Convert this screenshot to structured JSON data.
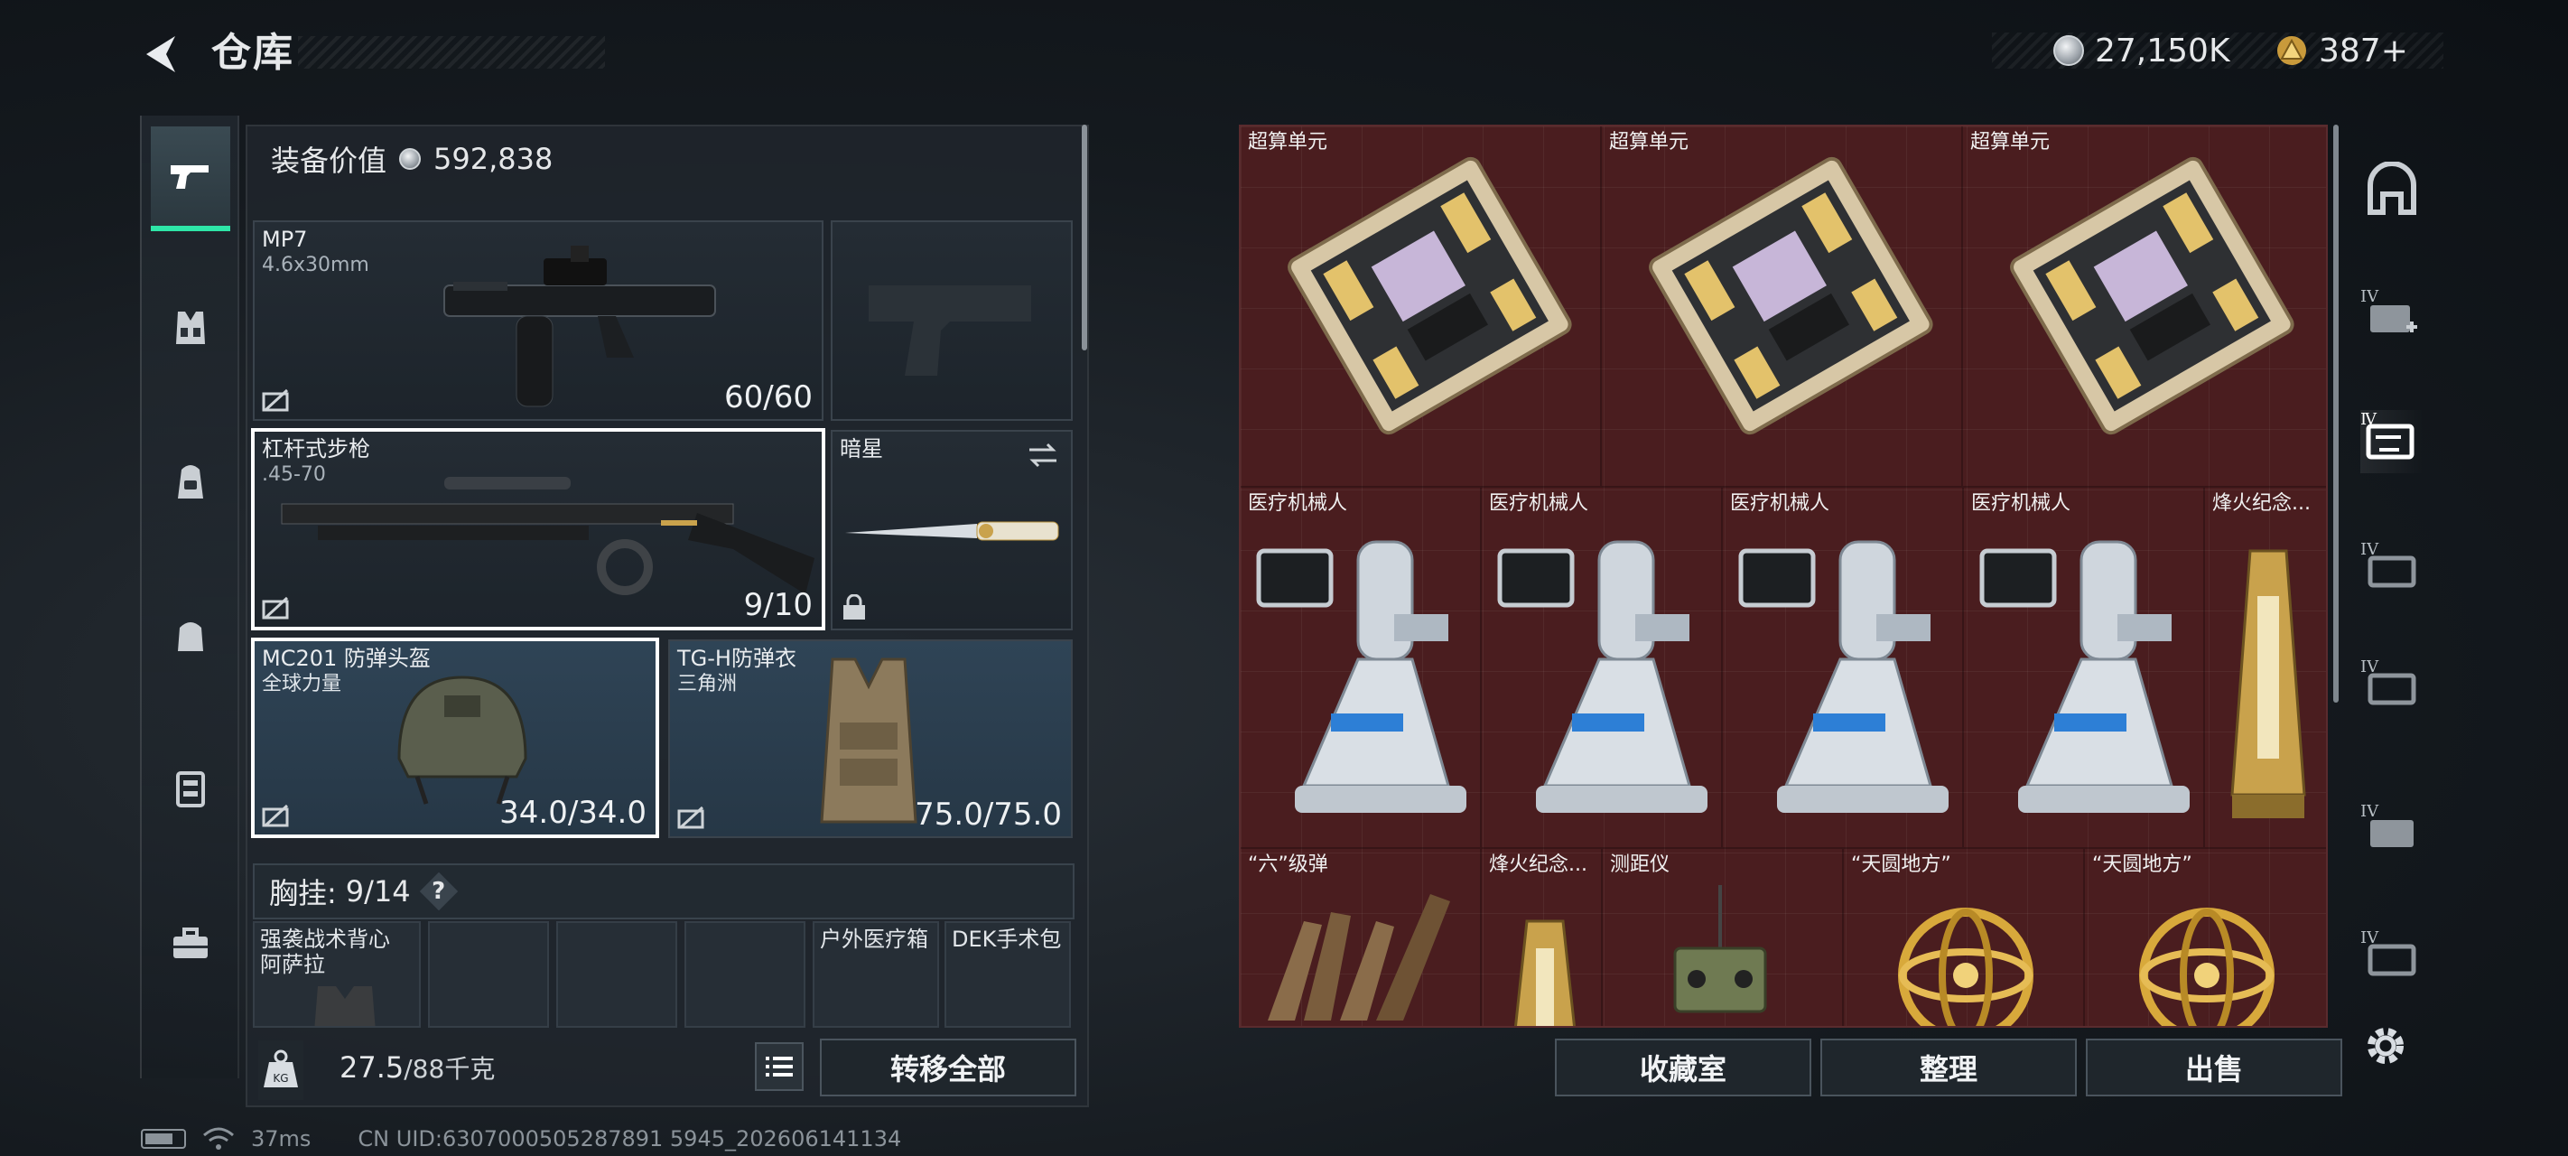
{
  "header": {
    "title": "仓库",
    "currency_silver": "27,150K",
    "currency_gold": "387+"
  },
  "loadout": {
    "equip_value_label": "装备价值",
    "equip_value": "592,838",
    "primary": {
      "name": "MP7",
      "sub": "4.6x30mm",
      "durability": "60/60"
    },
    "secondary": {
      "name": "杠杆式步枪",
      "sub": ".45-70",
      "durability": "9/10"
    },
    "melee": {
      "name": "暗星"
    },
    "helmet": {
      "name": "MC201 防弹头盔",
      "sub": "全球力量",
      "durability": "34.0/34.0"
    },
    "armor": {
      "name": "TG-H防弹衣",
      "sub": "三角洲",
      "durability": "75.0/75.0"
    },
    "chest_rig": {
      "label": "胸挂: ",
      "value": "9/14",
      "help": "?"
    },
    "rig_slots": [
      {
        "name": "强袭战术背心\n阿萨拉"
      },
      {
        "name": ""
      },
      {
        "name": ""
      },
      {
        "name": ""
      },
      {
        "name": "户外医疗箱"
      },
      {
        "name": "DEK手术包"
      }
    ],
    "weight": "27.5",
    "weight_max": "/88千克",
    "transfer_all": "转移全部"
  },
  "stash": {
    "items": [
      {
        "label": "超算单元",
        "kind": "chip"
      },
      {
        "label": "超算单元",
        "kind": "chip"
      },
      {
        "label": "超算单元",
        "kind": "chip"
      },
      {
        "label": "医疗机械人",
        "kind": "robot"
      },
      {
        "label": "医疗机械人",
        "kind": "robot"
      },
      {
        "label": "医疗机械人",
        "kind": "robot"
      },
      {
        "label": "医疗机械人",
        "kind": "robot"
      },
      {
        "label": "烽火纪念...",
        "kind": "trophy"
      },
      {
        "label": "“六”级弹",
        "kind": "bullets"
      },
      {
        "label": "烽火纪念...",
        "kind": "trophy"
      },
      {
        "label": "测距仪",
        "kind": "rangefinder"
      },
      {
        "label": "“天圆地方”",
        "kind": "sphere"
      },
      {
        "label": "“天圆地方”",
        "kind": "sphere"
      }
    ],
    "btn_collection": "收藏室",
    "btn_sort": "整理",
    "btn_sell": "出售"
  },
  "right_rail": {
    "tiers": [
      "IV",
      "IV",
      "IV",
      "IV",
      "IV"
    ]
  },
  "status": {
    "ping": "37ms",
    "uid": "CN UID:6307000505287891 5945_202606141134"
  },
  "colors": {
    "accent": "#2ee6a8",
    "stash_bg": "#4a1d1f",
    "panel_bg": "#20262d"
  }
}
